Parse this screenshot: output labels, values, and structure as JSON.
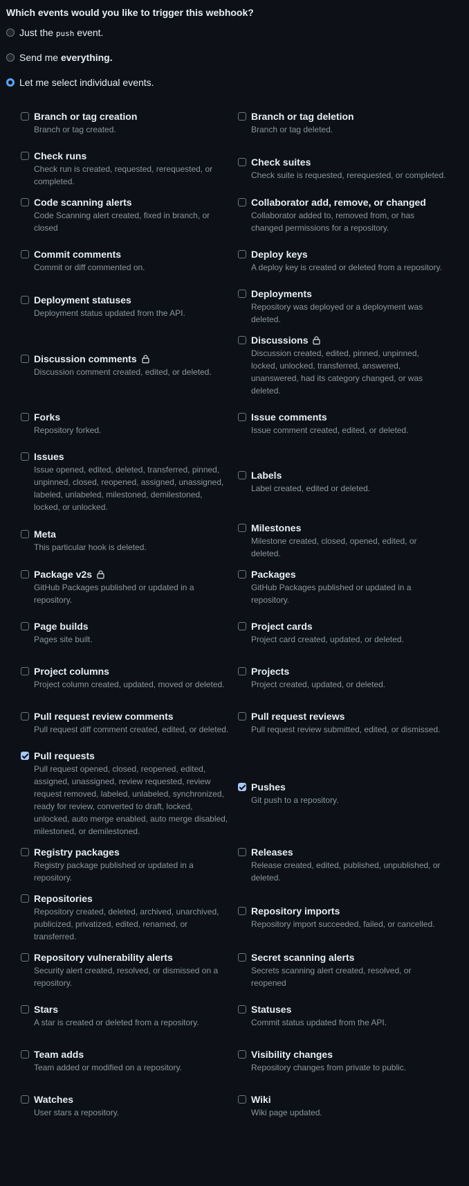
{
  "heading": "Which events would you like to trigger this webhook?",
  "radios": [
    {
      "prefix": "Just the ",
      "code": "push",
      "suffix": " event.",
      "checked": false
    },
    {
      "prefix": "Send me ",
      "bold": "everything.",
      "checked": false
    },
    {
      "prefix": "Let me select individual events.",
      "checked": true
    }
  ],
  "events": {
    "left": [
      {
        "title": "Branch or tag creation",
        "desc": "Branch or tag created.",
        "checked": false
      },
      {
        "title": "Check runs",
        "desc": "Check run is created, requested, rerequested, or completed.",
        "checked": false
      },
      {
        "title": "Code scanning alerts",
        "desc": "Code Scanning alert created, fixed in branch, or closed",
        "checked": false
      },
      {
        "title": "Commit comments",
        "desc": "Commit or diff commented on.",
        "checked": false
      },
      {
        "title": "Deployment statuses",
        "desc": "Deployment status updated from the API.",
        "checked": false
      },
      {
        "title": "Discussion comments",
        "desc": "Discussion comment created, edited, or deleted.",
        "checked": false,
        "lock": true
      },
      {
        "title": "Forks",
        "desc": "Repository forked.",
        "checked": false
      },
      {
        "title": "Issues",
        "desc": "Issue opened, edited, deleted, transferred, pinned, unpinned, closed, reopened, assigned, unassigned, labeled, unlabeled, milestoned, demilestoned, locked, or unlocked.",
        "checked": false
      },
      {
        "title": "Meta",
        "desc": "This particular hook is deleted.",
        "checked": false
      },
      {
        "title": "Package v2s",
        "desc": "GitHub Packages published or updated in a repository.",
        "checked": false,
        "lock": true
      },
      {
        "title": "Page builds",
        "desc": "Pages site built.",
        "checked": false
      },
      {
        "title": "Project columns",
        "desc": "Project column created, updated, moved or deleted.",
        "checked": false
      },
      {
        "title": "Pull request review comments",
        "desc": "Pull request diff comment created, edited, or deleted.",
        "checked": false
      },
      {
        "title": "Pull requests",
        "desc": "Pull request opened, closed, reopened, edited, assigned, unassigned, review requested, review request removed, labeled, unlabeled, synchronized, ready for review, converted to draft, locked, unlocked, auto merge enabled, auto merge disabled, milestoned, or demilestoned.",
        "checked": true
      },
      {
        "title": "Registry packages",
        "desc": "Registry package published or updated in a repository.",
        "checked": false
      },
      {
        "title": "Repositories",
        "desc": "Repository created, deleted, archived, unarchived, publicized, privatized, edited, renamed, or transferred.",
        "checked": false
      },
      {
        "title": "Repository vulnerability alerts",
        "desc": "Security alert created, resolved, or dismissed on a repository.",
        "checked": false
      },
      {
        "title": "Stars",
        "desc": "A star is created or deleted from a repository.",
        "checked": false
      },
      {
        "title": "Team adds",
        "desc": "Team added or modified on a repository.",
        "checked": false
      },
      {
        "title": "Watches",
        "desc": "User stars a repository.",
        "checked": false
      }
    ],
    "right": [
      {
        "title": "Branch or tag deletion",
        "desc": "Branch or tag deleted.",
        "checked": false
      },
      {
        "title": "Check suites",
        "desc": "Check suite is requested, rerequested, or completed.",
        "checked": false
      },
      {
        "title": "Collaborator add, remove, or changed",
        "desc": "Collaborator added to, removed from, or has changed permissions for a repository.",
        "checked": false
      },
      {
        "title": "Deploy keys",
        "desc": "A deploy key is created or deleted from a repository.",
        "checked": false
      },
      {
        "title": "Deployments",
        "desc": "Repository was deployed or a deployment was deleted.",
        "checked": false
      },
      {
        "title": "Discussions",
        "desc": "Discussion created, edited, pinned, unpinned, locked, unlocked, transferred, answered, unanswered, had its category changed, or was deleted.",
        "checked": false,
        "lock": true
      },
      {
        "title": "Issue comments",
        "desc": "Issue comment created, edited, or deleted.",
        "checked": false
      },
      {
        "title": "Labels",
        "desc": "Label created, edited or deleted.",
        "checked": false
      },
      {
        "title": "Milestones",
        "desc": "Milestone created, closed, opened, edited, or deleted.",
        "checked": false
      },
      {
        "title": "Packages",
        "desc": "GitHub Packages published or updated in a repository.",
        "checked": false
      },
      {
        "title": "Project cards",
        "desc": "Project card created, updated, or deleted.",
        "checked": false
      },
      {
        "title": "Projects",
        "desc": "Project created, updated, or deleted.",
        "checked": false
      },
      {
        "title": "Pull request reviews",
        "desc": "Pull request review submitted, edited, or dismissed.",
        "checked": false
      },
      {
        "title": "Pushes",
        "desc": "Git push to a repository.",
        "checked": true
      },
      {
        "title": "Releases",
        "desc": "Release created, edited, published, unpublished, or deleted.",
        "checked": false
      },
      {
        "title": "Repository imports",
        "desc": "Repository import succeeded, failed, or cancelled.",
        "checked": false
      },
      {
        "title": "Secret scanning alerts",
        "desc": "Secrets scanning alert created, resolved, or reopened",
        "checked": false
      },
      {
        "title": "Statuses",
        "desc": "Commit status updated from the API.",
        "checked": false
      },
      {
        "title": "Visibility changes",
        "desc": "Repository changes from private to public.",
        "checked": false
      },
      {
        "title": "Wiki",
        "desc": "Wiki page updated.",
        "checked": false
      }
    ]
  }
}
